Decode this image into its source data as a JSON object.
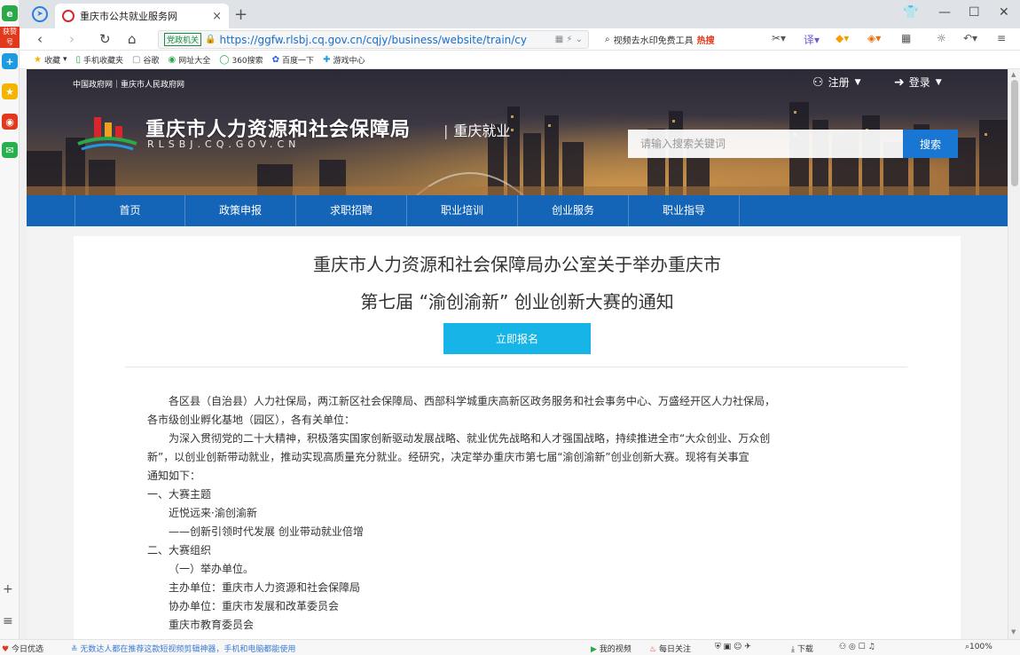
{
  "browser": {
    "sidebar": {
      "badge": "获赞号"
    },
    "tab": {
      "title": "重庆市公共就业服务网",
      "close": "×",
      "new_tab": "+"
    },
    "window_controls": {
      "skin": "👕",
      "minimize": "—",
      "maximize": "☐",
      "close": "✕"
    },
    "nav": {
      "back": "‹",
      "forward": "›",
      "reload": "↻",
      "home": "⌂"
    },
    "address": {
      "badge": "党政机关",
      "url": "https://ggfw.rlsbj.cq.gov.cn/cqjy/business/website/train/cy",
      "search_text": "视频去水印免费工具",
      "search_hot": "热搜"
    },
    "bookmarks": [
      {
        "icon": "★",
        "label": "收藏"
      },
      {
        "icon": "▯",
        "label": "手机收藏夹"
      },
      {
        "icon": "▢",
        "label": "谷歌"
      },
      {
        "icon": "◉",
        "label": "网址大全"
      },
      {
        "icon": "◯",
        "label": "360搜索"
      },
      {
        "icon": "✿",
        "label": "百度一下"
      },
      {
        "icon": "✚",
        "label": "游戏中心"
      }
    ],
    "zoom": "100%"
  },
  "header": {
    "gov_links": "中国政府网｜重庆市人民政府网",
    "site_title": "重庆市人力资源和社会保障局",
    "site_subtitle": "重庆就业",
    "site_domain": "RLSBJ.CQ.GOV.CN",
    "register": "注册",
    "login": "登录",
    "search_placeholder": "请输入搜索关键词",
    "search_button": "搜索"
  },
  "nav": {
    "items": [
      "首页",
      "政策申报",
      "求职招聘",
      "职业培训",
      "创业服务",
      "职业指导"
    ]
  },
  "article": {
    "title_line1": "重庆市人力资源和社会保障局办公室关于举办重庆市",
    "title_line2": "第七届 “渝创渝新” 创业创新大赛的通知",
    "signup_button": "立即报名",
    "paragraphs": [
      "各区县（自治县）人力社保局，两江新区社会保障局、西部科学城重庆高新区政务服务和社会事务中心、万盛经开区人力社保局，",
      "各市级创业孵化基地（园区），各有关单位：",
      "为深入贯彻党的二十大精神，积极落实国家创新驱动发展战略、就业优先战略和人才强国战略，持续推进全市“大众创业、万众创",
      "新”，以创业创新带动就业，推动实现高质量充分就业。经研究，决定举办重庆市第七届“渝创渝新”创业创新大赛。现将有关事宜",
      "通知如下：",
      "一、大赛主题",
      "近悦远来·渝创渝新",
      "——创新引领时代发展  创业带动就业倍增",
      "二、大赛组织",
      "（一）举办单位。",
      "主办单位：重庆市人力资源和社会保障局",
      "协办单位：重庆市发展和改革委员会",
      "重庆市教育委员会"
    ]
  },
  "statusbar": {
    "left_label": "今日优选",
    "promo": "无数达人都在推荐这款短视频剪辑神器，手机和电脑都能使用",
    "my_video": "我的视频",
    "daily": "每日关注",
    "download": "下载",
    "zoom": "100%"
  }
}
